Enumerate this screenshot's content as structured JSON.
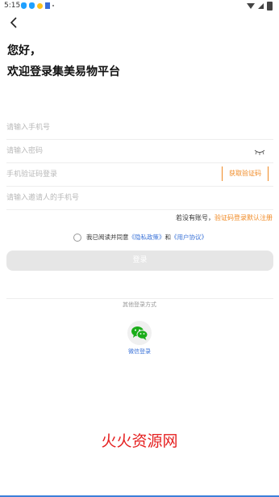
{
  "status_bar": {
    "time": "5:15"
  },
  "greeting": {
    "line1": "您好，",
    "line2": "欢迎登录集美易物平台"
  },
  "form": {
    "phone_placeholder": "请输入手机号",
    "password_placeholder": "请输入密码",
    "sms_placeholder": "手机验证码登录",
    "code_button": "获取验证码",
    "inviter_placeholder": "请输入邀请人的手机号"
  },
  "register": {
    "prefix": "若没有账号，",
    "link": "验证码登录默认注册"
  },
  "agreement": {
    "text": "我已阅读并同意",
    "privacy": "《隐私政策》",
    "and": "和",
    "user": "《用户协议》"
  },
  "login_button": "登录",
  "other_login": {
    "label": "其他登录方式",
    "wechat": "微信登录"
  },
  "watermark": "火火资源网",
  "colors": {
    "accent": "#f08a24",
    "link": "#3b73d8",
    "wechat": "#1aad19"
  }
}
